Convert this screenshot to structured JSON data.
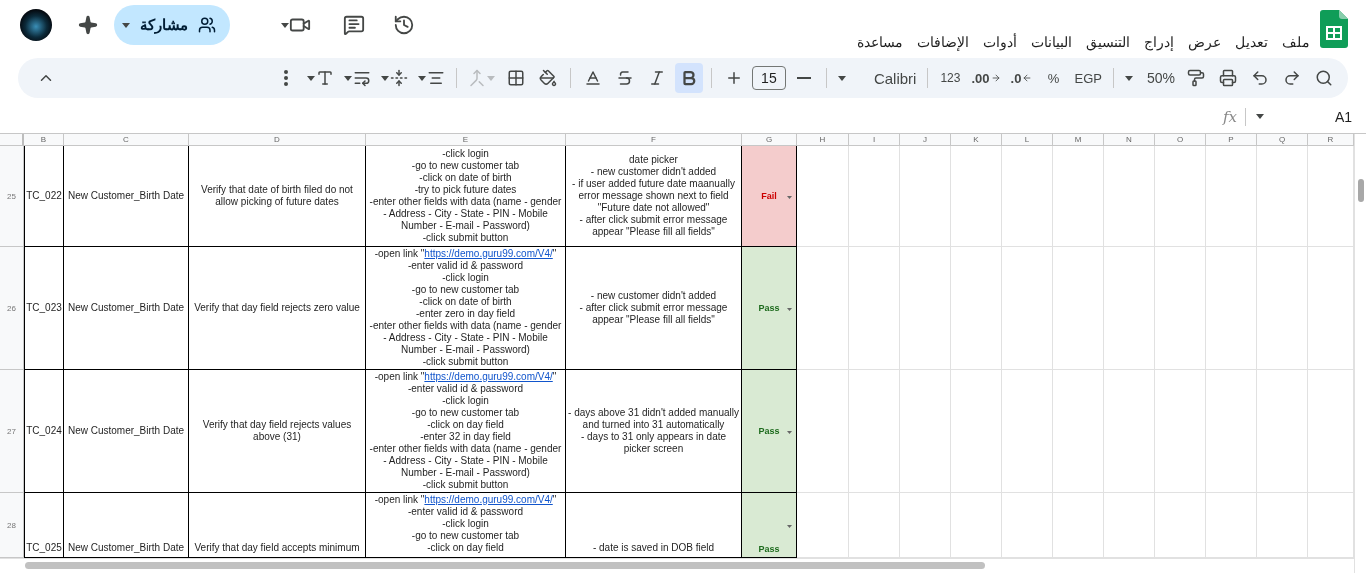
{
  "menu": [
    "ملف",
    "تعديل",
    "عرض",
    "إدراج",
    "التنسيق",
    "البيانات",
    "أدوات",
    "الإضافات",
    "مساعدة"
  ],
  "share": {
    "label": "مشاركة"
  },
  "toolbar": {
    "zoom": "50%",
    "currency": "EGP",
    "percent": "%",
    "decrease_decimal": ".0",
    "increase_decimal": ".00",
    "number_format": "123",
    "font": "Calibri",
    "font_size": "15",
    "bold": {
      "on": true
    },
    "merge": {
      "disabled": true
    }
  },
  "formula_bar": {
    "fx": "fx",
    "cell_ref": "A1"
  },
  "columns": [
    "B",
    "C",
    "D",
    "E",
    "F",
    "G",
    "H",
    "I",
    "J",
    "K",
    "L",
    "M",
    "N",
    "O",
    "P",
    "Q",
    "R"
  ],
  "rows": [
    {
      "number": "25",
      "id": "TC_022",
      "module": "New Customer_Birth Date",
      "description": "Verify that date of birth filed do not allow picking of future dates",
      "steps": [
        {
          "text": "-click login"
        },
        {
          "text": "-go to new customer tab"
        },
        {
          "text": "-click on date of birth"
        },
        {
          "text": "-try to pick future dates"
        },
        {
          "text": "-enter other fields with data (name - gender"
        },
        {
          "text": "- Address - City - State - PIN - Mobile"
        },
        {
          "text": "Number - E-mail - Password)"
        },
        {
          "text": "-click submit button"
        }
      ],
      "expected": [
        "date picker",
        "- new customer didn't added",
        "- if user added future date maanually",
        "error message shown next to field",
        "\"Future date not allowed\"",
        "- after click submit error message",
        "appear \"Please fill all fields\""
      ],
      "status": {
        "kind": "fail",
        "text": "Fail"
      }
    },
    {
      "number": "26",
      "id": "TC_023",
      "module": "New Customer_Birth Date",
      "description": "Verify that day field rejects zero value",
      "steps": [
        {
          "text": "-open link \"",
          "link": "https://demo.guru99.com/V4/",
          "after": "\""
        },
        {
          "text": "-enter valid id & password"
        },
        {
          "text": "-click login"
        },
        {
          "text": "-go to new customer tab"
        },
        {
          "text": "-click on date of birth"
        },
        {
          "text": "-enter zero in day field"
        },
        {
          "text": "-enter other fields with data (name - gender"
        },
        {
          "text": "- Address - City - State - PIN - Mobile"
        },
        {
          "text": "Number - E-mail - Password)"
        },
        {
          "text": "-click submit button"
        }
      ],
      "expected": [
        "- new customer didn't added",
        "- after click submit error message",
        "appear \"Please fill all fields\""
      ],
      "status": {
        "kind": "pass",
        "text": "Pass"
      }
    },
    {
      "number": "27",
      "id": "TC_024",
      "module": "New Customer_Birth Date",
      "description": "Verify that day field rejects values above (31)",
      "steps": [
        {
          "text": "-open link \"",
          "link": "https://demo.guru99.com/V4/",
          "after": "\""
        },
        {
          "text": "-enter valid id & password"
        },
        {
          "text": "-click login"
        },
        {
          "text": "-go to new customer tab"
        },
        {
          "text": "-click on day field"
        },
        {
          "text": "-enter 32 in day field"
        },
        {
          "text": "-enter other fields with data (name - gender"
        },
        {
          "text": "- Address - City - State - PIN - Mobile"
        },
        {
          "text": "Number - E-mail - Password)"
        },
        {
          "text": "-click submit button"
        }
      ],
      "expected": [
        "- days above 31 didn't added manually",
        "and turned into 31 automatically",
        "- days to 31 only appears in date",
        "picker screen"
      ],
      "status": {
        "kind": "pass",
        "text": "Pass"
      }
    },
    {
      "number": "28",
      "id": "TC_025",
      "module": "New Customer_Birth Date",
      "description": "Verify that day field accepts minimum",
      "steps": [
        {
          "text": "-open link \"",
          "link": "https://demo.guru99.com/V4/",
          "after": "\""
        },
        {
          "text": "-enter valid id & password"
        },
        {
          "text": "-click login"
        },
        {
          "text": "-go to new customer tab"
        },
        {
          "text": "-click on day field"
        }
      ],
      "expected": [
        "- date is saved in DOB field"
      ],
      "status": {
        "kind": "pass",
        "text": "Pass"
      }
    }
  ]
}
